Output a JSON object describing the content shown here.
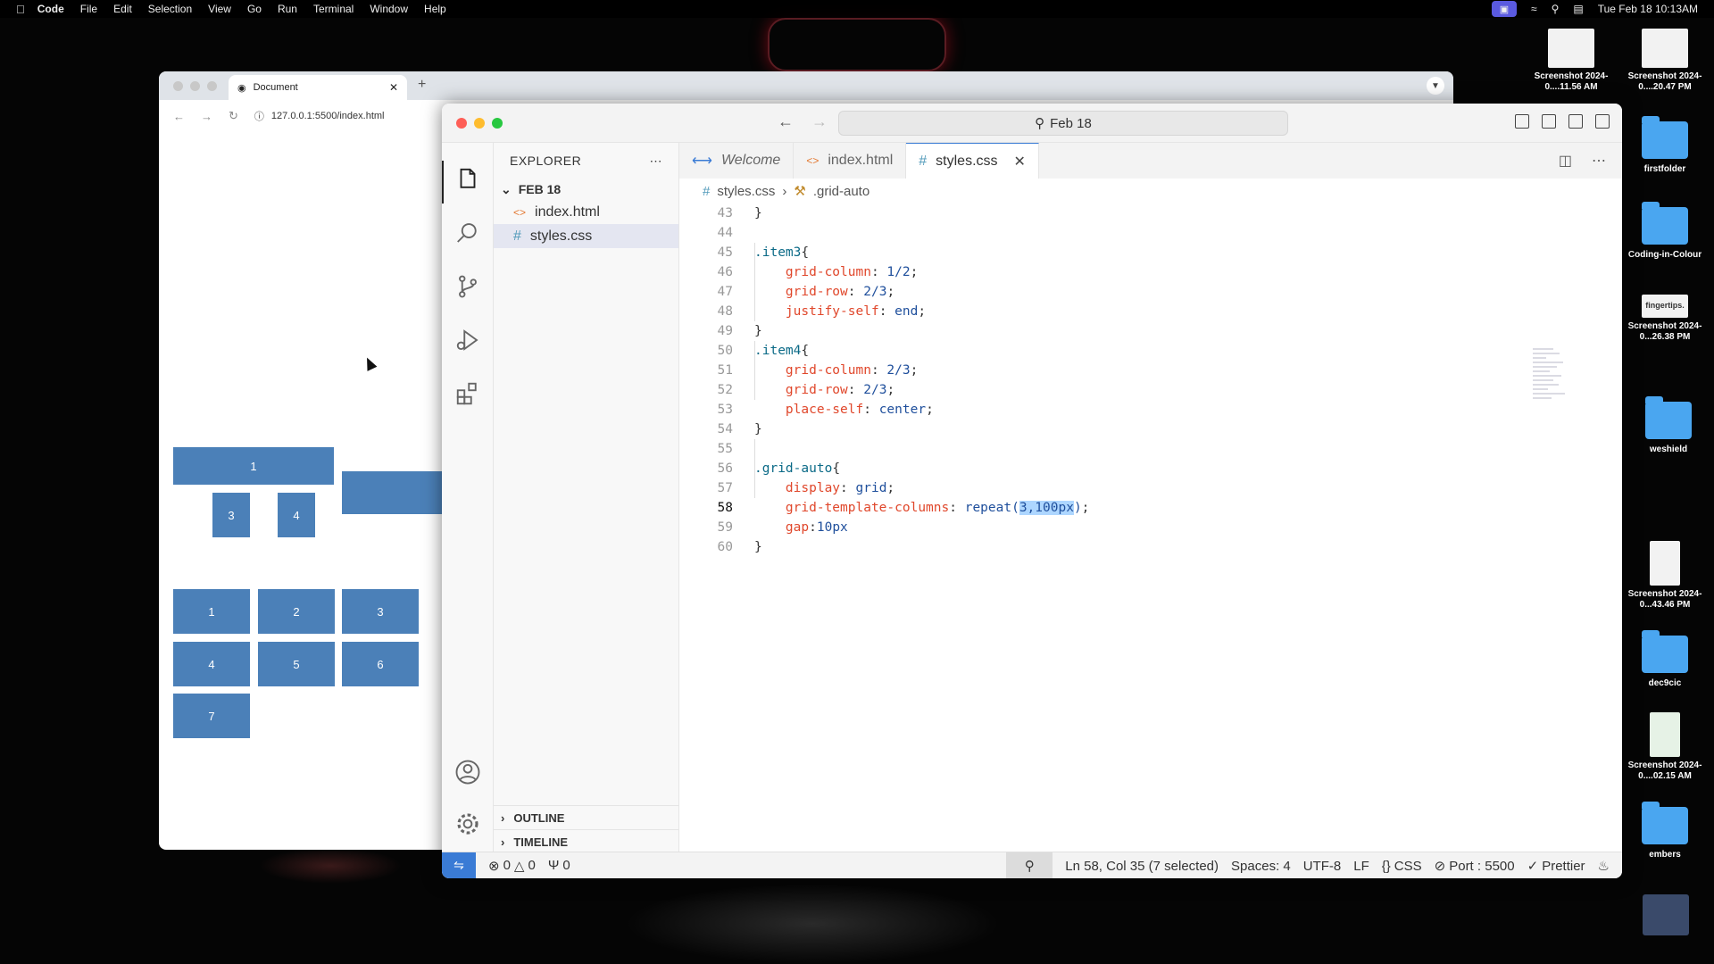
{
  "menubar": {
    "app": "Code",
    "items": [
      "File",
      "Edit",
      "Selection",
      "View",
      "Go",
      "Run",
      "Terminal",
      "Window",
      "Help"
    ],
    "clock": "Tue Feb 18  10:13AM"
  },
  "desktop": {
    "icons": [
      {
        "label": "Screenshot 2024-0....11.56 AM",
        "kind": "thumb"
      },
      {
        "label": "Screenshot 2024-0....20.47 PM",
        "kind": "thumb"
      },
      {
        "label": "firstfolder",
        "kind": "folder"
      },
      {
        "label": "Coding-in-Colour",
        "kind": "folder"
      },
      {
        "label": "Screenshot 2024-0...26.38 PM",
        "kind": "thumb",
        "thumb_text": "fingertips."
      },
      {
        "label": "weshield",
        "kind": "folder"
      },
      {
        "label": "Screenshot 2024-0...43.46 PM",
        "kind": "thumb"
      },
      {
        "label": "dec9cic",
        "kind": "folder"
      },
      {
        "label": "Screenshot 2024-0....02.15 AM",
        "kind": "thumb"
      },
      {
        "label": "embers",
        "kind": "folder"
      }
    ]
  },
  "browser": {
    "tab_title": "Document",
    "url": "127.0.0.1:5500/index.html",
    "grid1": [
      "1",
      "3",
      "4"
    ],
    "grid2": [
      "1",
      "2",
      "3",
      "4",
      "5",
      "6",
      "7"
    ]
  },
  "vscode": {
    "title_search": "Feb 18",
    "explorer_title": "EXPLORER",
    "folder": "FEB 18",
    "files": [
      "index.html",
      "styles.css"
    ],
    "sections": [
      "OUTLINE",
      "TIMELINE"
    ],
    "tabs": [
      "Welcome",
      "index.html",
      "styles.css"
    ],
    "breadcrumb": [
      "styles.css",
      ".grid-auto"
    ],
    "code_lines": [
      {
        "n": "43",
        "text": "}"
      },
      {
        "n": "44",
        "text": ""
      },
      {
        "n": "45",
        "text": ".item3{"
      },
      {
        "n": "46",
        "text": "    grid-column: 1/2;"
      },
      {
        "n": "47",
        "text": "    grid-row: 2/3;"
      },
      {
        "n": "48",
        "text": "    justify-self: end;"
      },
      {
        "n": "49",
        "text": "}"
      },
      {
        "n": "50",
        "text": ".item4{"
      },
      {
        "n": "51",
        "text": "    grid-column: 2/3;"
      },
      {
        "n": "52",
        "text": "    grid-row: 2/3;"
      },
      {
        "n": "53",
        "text": "    place-self: center;"
      },
      {
        "n": "54",
        "text": "}"
      },
      {
        "n": "55",
        "text": ""
      },
      {
        "n": "56",
        "text": ".grid-auto{"
      },
      {
        "n": "57",
        "text": "    display: grid;"
      },
      {
        "n": "58",
        "text": "    grid-template-columns: repeat(3,100px);"
      },
      {
        "n": "59",
        "text": "    gap:10px"
      },
      {
        "n": "60",
        "text": "}"
      }
    ],
    "current_line": "58",
    "status": {
      "errors": "0",
      "warnings": "0",
      "ports": "0",
      "position": "Ln 58, Col 35 (7 selected)",
      "spaces": "Spaces: 4",
      "encoding": "UTF-8",
      "eol": "LF",
      "language": "CSS",
      "port": "Port : 5500",
      "prettier": "Prettier"
    }
  },
  "colors": {
    "accent": "#3a7bd5",
    "grid_cell": "#4b80b8"
  }
}
